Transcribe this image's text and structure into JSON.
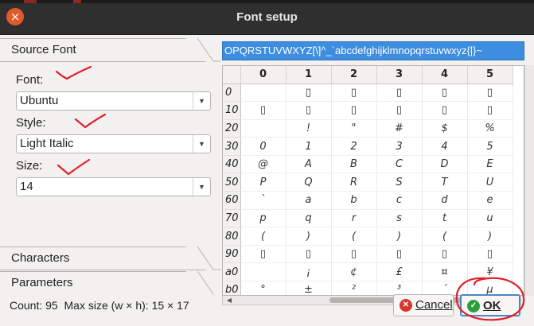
{
  "window": {
    "title": "Font setup",
    "close_glyph": "×"
  },
  "left_panel": {
    "source_font_header": "Source Font",
    "font_label": "Font:",
    "font_value": "Ubuntu",
    "style_label": "Style:",
    "style_value": "Light Italic",
    "size_label": "Size:",
    "size_value": "14",
    "characters_header": "Characters",
    "parameters_header": "Parameters"
  },
  "chars_field_value": "OPQRSTUVWXYZ[\\]^_`abcdefghijklmnopqrstuvwxyz{|}~",
  "grid": {
    "columns": [
      "0",
      "1",
      "2",
      "3",
      "4",
      "5"
    ],
    "rows": [
      {
        "head": "0",
        "cells": [
          "",
          "▯",
          "▯",
          "▯",
          "▯",
          "▯"
        ]
      },
      {
        "head": "10",
        "cells": [
          "▯",
          "▯",
          "▯",
          "▯",
          "▯",
          "▯"
        ]
      },
      {
        "head": "20",
        "cells": [
          "",
          "!",
          "\"",
          "#",
          "$",
          "%"
        ]
      },
      {
        "head": "30",
        "cells": [
          "0",
          "1",
          "2",
          "3",
          "4",
          "5"
        ]
      },
      {
        "head": "40",
        "cells": [
          "@",
          "A",
          "B",
          "C",
          "D",
          "E"
        ]
      },
      {
        "head": "50",
        "cells": [
          "P",
          "Q",
          "R",
          "S",
          "T",
          "U"
        ]
      },
      {
        "head": "60",
        "cells": [
          "`",
          "a",
          "b",
          "c",
          "d",
          "e"
        ]
      },
      {
        "head": "70",
        "cells": [
          "p",
          "q",
          "r",
          "s",
          "t",
          "u"
        ]
      },
      {
        "head": "80",
        "cells": [
          "(",
          ")",
          "(",
          ")",
          "(",
          ")"
        ]
      },
      {
        "head": "90",
        "cells": [
          "▯",
          "▯",
          "▯",
          "▯",
          "▯",
          "▯"
        ]
      },
      {
        "head": "a0",
        "cells": [
          "",
          "¡",
          "¢",
          "£",
          "¤",
          "¥"
        ]
      },
      {
        "head": "b0",
        "cells": [
          "°",
          "±",
          "²",
          "³",
          "´",
          "µ"
        ]
      }
    ]
  },
  "status": {
    "count_text": "Count: 95",
    "max_size_text": "Max size (w × h): 15 × 17"
  },
  "buttons": {
    "cancel_label": "Cancel",
    "ok_label": "OK"
  },
  "colors": {
    "title_bg": "#2f2f2f",
    "selection_blue": "#3d8ee0",
    "annotation_red": "#e0202a",
    "ok_green": "#2f9e3a",
    "cancel_red": "#d7362a"
  },
  "icons": {
    "close": "close-icon",
    "cancel": "cancel-icon",
    "ok": "check-icon"
  }
}
